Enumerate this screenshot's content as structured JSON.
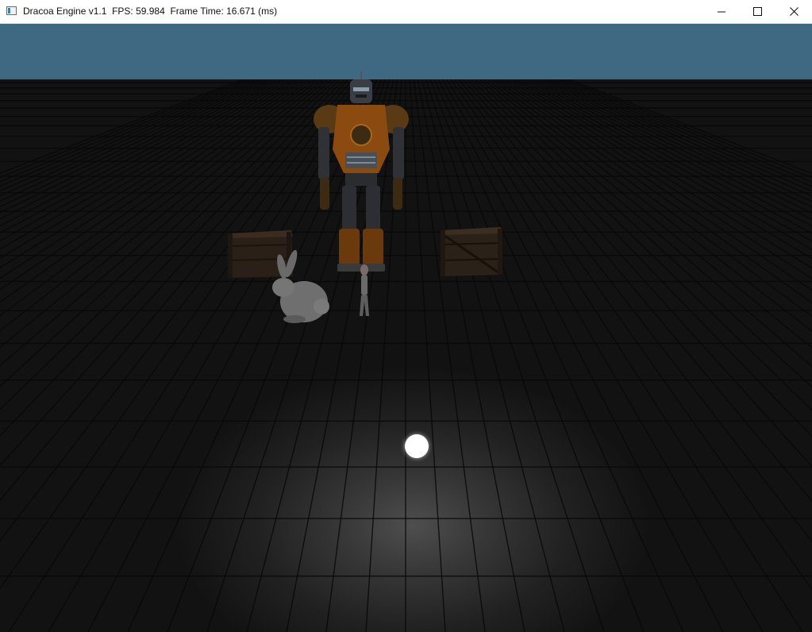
{
  "window": {
    "title": "Dracoa Engine v1.1  FPS: 59.984  Frame Time: 16.671 (ms)"
  },
  "scene": {
    "sky_color": "#3f6883",
    "floor_color": "#2a2a2a",
    "light_color": "#ffffff",
    "robot_accent": "#b8600f"
  }
}
